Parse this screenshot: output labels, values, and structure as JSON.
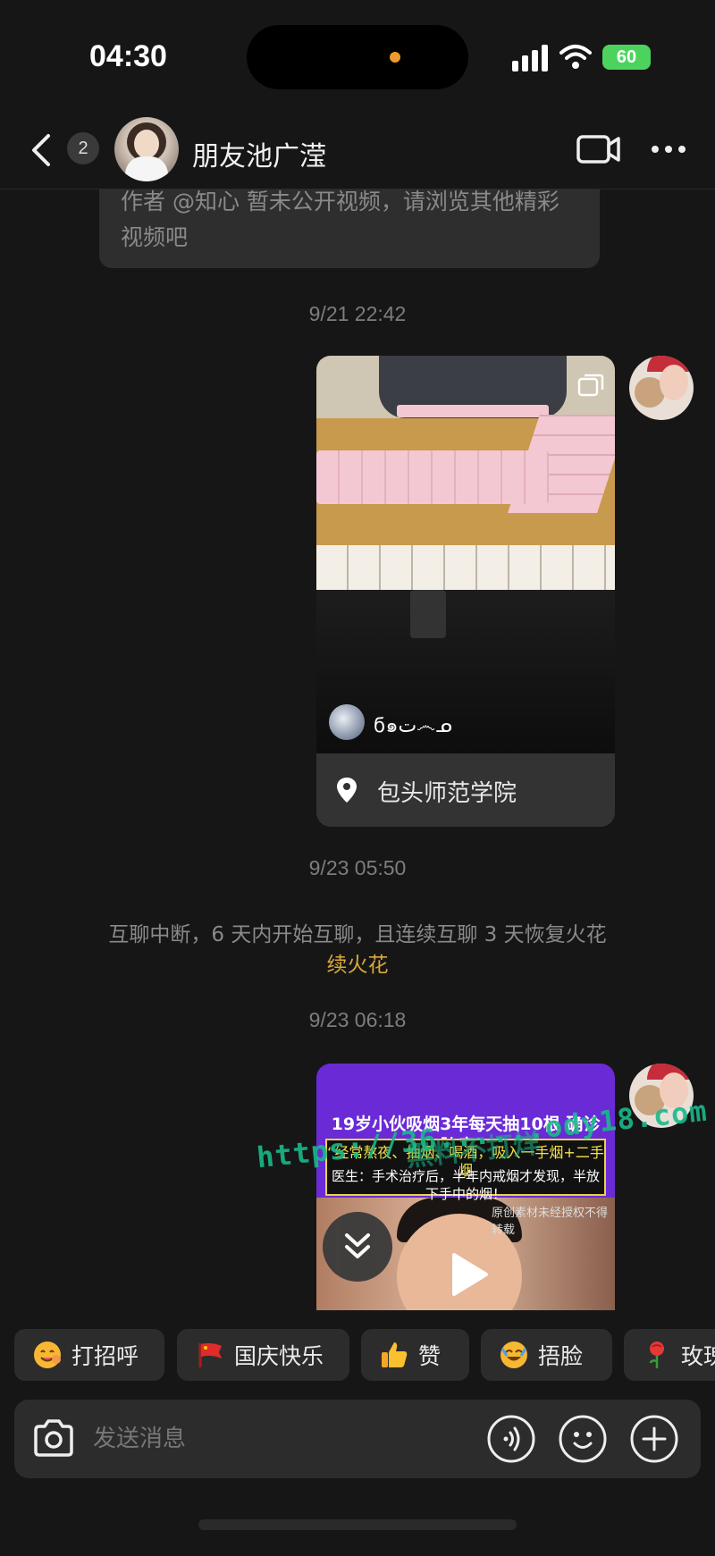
{
  "status_bar": {
    "time": "04:30",
    "battery": "60"
  },
  "header": {
    "unread_count": "2",
    "contact_name": "朋友池广滢"
  },
  "messages": {
    "first_bubble_text": "作者 @知心 暂未公开视频，请浏览其他精彩视频吧",
    "timestamp_1": "9/21 22:42",
    "video_1": {
      "author": "ϭ๑ت෴ᓄ",
      "location": "包头师范学院"
    },
    "timestamp_2": "9/23 05:50",
    "notice": "互聊中断，6 天内开始互聊，且连续互聊 3 天恢复火花",
    "notice_link": "续火花",
    "timestamp_3": "9/23 06:18",
    "video_2": {
      "headline": "19岁小伙吸烟3年每天抽10根 确诊肺癌！",
      "sub_line_1": "“经常熬夜、抽烟、喝酒，吸入一手烟+二手烟",
      "sub_line_2": "医生：手术治疗后，半年内戒烟才发现，半放下手中的烟！",
      "credit": "原创素材未经授权不得转载"
    }
  },
  "watermark": "https://36......ody18.com",
  "watermark_overlay": "黑料不打烊",
  "quick_replies": [
    {
      "label": "打招呼",
      "icon": "smiling-face-icon"
    },
    {
      "label": "国庆快乐",
      "icon": "red-flag-icon"
    },
    {
      "label": "赞",
      "icon": "thumbs-up-icon"
    },
    {
      "label": "捂脸",
      "icon": "facepalm-icon"
    },
    {
      "label": "玫瑰",
      "icon": "rose-icon"
    }
  ],
  "input": {
    "placeholder": "发送消息"
  },
  "colors": {
    "background": "#161616",
    "bubble": "#2e2e2e",
    "accent_link": "#d9a93a",
    "battery": "#4cd35e"
  }
}
